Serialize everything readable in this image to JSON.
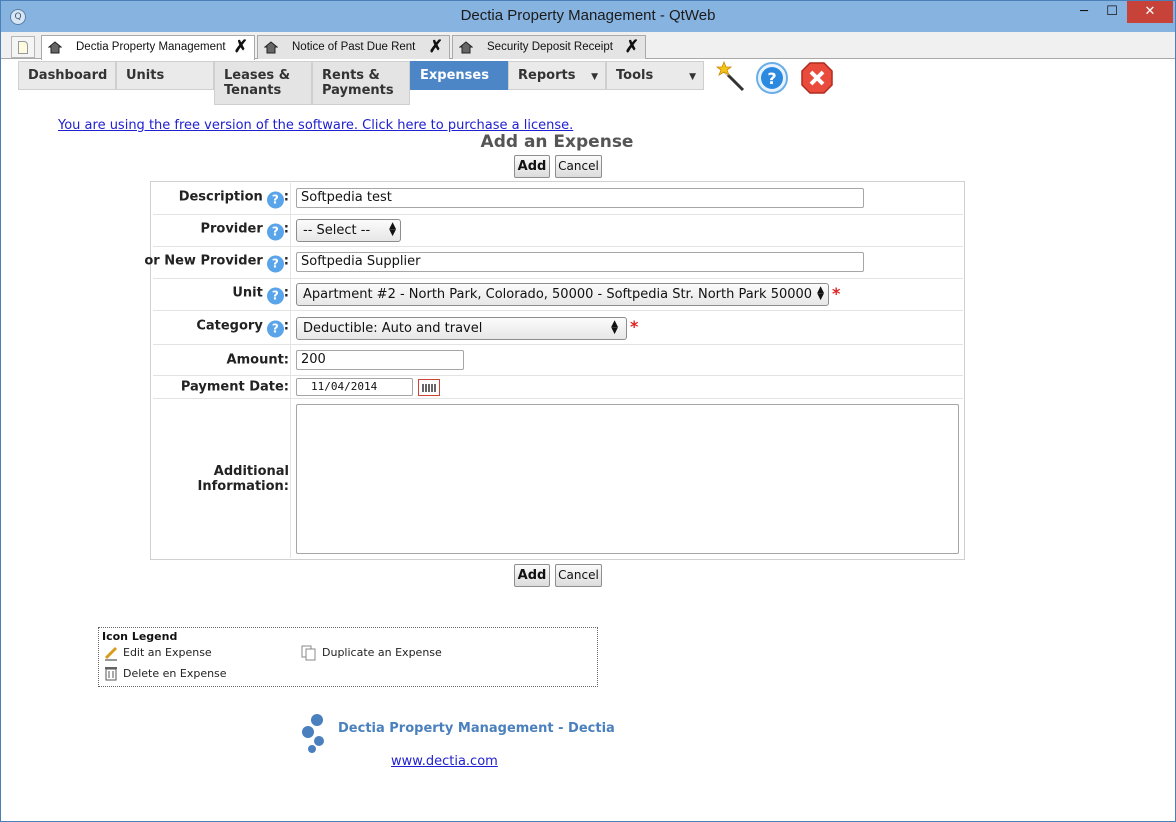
{
  "window": {
    "title": "Dectia Property Management - QtWeb",
    "minimize": "─",
    "maximize": "☐",
    "close": "✕"
  },
  "tabs": [
    {
      "label": "Dectia Property Management",
      "close": "✗"
    },
    {
      "label": "Notice of Past Due Rent",
      "close": "✗"
    },
    {
      "label": "Security Deposit Receipt",
      "close": "✗"
    }
  ],
  "nav": {
    "dashboard": "Dashboard",
    "units": "Units",
    "leases_line1": "Leases &",
    "leases_line2": "Tenants",
    "rents_line1": "Rents &",
    "rents_line2": "Payments",
    "expenses": "Expenses",
    "reports": "Reports",
    "tools": "Tools"
  },
  "license_notice": "You are using the free version of the software. Click here to purchase a license.",
  "page_title": "Add an Expense",
  "buttons": {
    "add": "Add",
    "cancel": "Cancel"
  },
  "form": {
    "description": {
      "label": "Description",
      "value": "Softpedia test"
    },
    "provider": {
      "label": "Provider",
      "value": "-- Select --"
    },
    "new_provider": {
      "label": "or New Provider",
      "value": "Softpedia Supplier"
    },
    "unit": {
      "label": "Unit",
      "value": "Apartment #2 - North Park, Colorado, 50000 - Softpedia Str. North Park 50000"
    },
    "category": {
      "label": "Category",
      "value": "Deductible: Auto and travel"
    },
    "amount": {
      "label": "Amount:",
      "value": "200"
    },
    "payment_date": {
      "label": "Payment Date:",
      "value": "11/04/2014"
    },
    "additional_info": {
      "label_line1": "Additional",
      "label_line2": "Information:",
      "value": ""
    },
    "colon": ":",
    "required_mark": "*",
    "help_glyph": "?"
  },
  "legend": {
    "title": "Icon Legend",
    "edit": "Edit an Expense",
    "duplicate": "Duplicate an Expense",
    "delete": "Delete en Expense"
  },
  "footer": {
    "brand": "Dectia Property Management - Dectia",
    "link": "www.dectia.com"
  },
  "colors": {
    "titlebar": "#87b3e0",
    "nav_active": "#4d86c6",
    "link": "#2020d0",
    "required": "#d22222",
    "help": "#5aa5ea"
  }
}
